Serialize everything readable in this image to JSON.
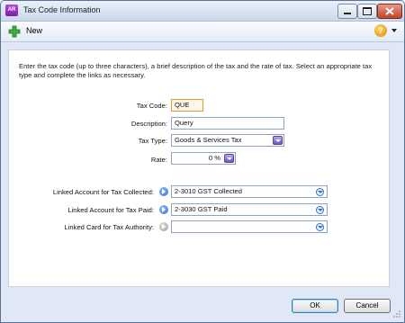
{
  "window": {
    "title": "Tax Code Information",
    "app_icon_text": "AR"
  },
  "toolbar": {
    "new_label": "New",
    "help_icon_text": "?"
  },
  "form": {
    "instructions": "Enter the tax code (up to three characters), a brief description of the tax and the rate of tax. Select an appropriate tax type and complete the links as necessary.",
    "tax_code": {
      "label": "Tax Code:",
      "value": "QUE"
    },
    "description": {
      "label": "Description:",
      "value": "Query"
    },
    "tax_type": {
      "label": "Tax Type:",
      "value": "Goods & Services Tax"
    },
    "rate": {
      "label": "Rate:",
      "value": "0 %"
    },
    "linked_collected": {
      "label": "Linked Account for Tax Collected:",
      "value": "2-3010 GST Collected"
    },
    "linked_paid": {
      "label": "Linked Account for Tax Paid:",
      "value": "2-3030 GST Paid"
    },
    "linked_card": {
      "label": "Linked Card for Tax Authority:",
      "value": ""
    }
  },
  "buttons": {
    "ok": "OK",
    "cancel": "Cancel"
  },
  "colors": {
    "accent": "#2b6ad3",
    "code_field_border": "#e39b3a",
    "combo_button": "#6f55c2"
  }
}
